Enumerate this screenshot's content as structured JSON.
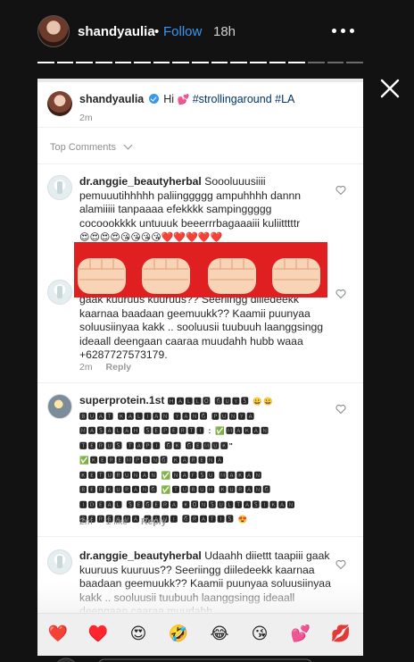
{
  "story": {
    "username": "shandyaulia",
    "separator": "•",
    "follow_label": "Follow",
    "time_ago": "18h",
    "progress_total": 17,
    "progress_current": 14
  },
  "post": {
    "username": "shandyaulia",
    "caption_hi": "Hi",
    "caption_tags": "#strollingaround #LA",
    "age": "2m"
  },
  "top_comments_label": "Top Comments",
  "comments": [
    {
      "username": "dr.anggie_beautyherbal",
      "text": "Soooluuusiiii pemuuutihhhhh paliinggggg ampuhhhh dannn alamiiiii tanpaaaa efekkkk sampinggggg cocoookkkk untuuuk beeerrrbagaaaiii kuliitttttr",
      "emojis": "😍😍😍😍😘😘😘😘❤️❤️❤️❤️❤️"
    },
    {
      "text": "gaak kuuruus kuuruus?? Seeriingg diiledeekk kaarnaa baadaan geemuukk?? Kaamii puunyaa soluusiinyaa kakk .. sooluusii tuubuuh laanggsingg ideaall deengaan caaraa muudahh hubb waaa +6287727573179.",
      "age": "2m",
      "reply": "Reply"
    },
    {
      "username": "superprotein.1st",
      "text_lines": [
        "🅷🅰🅻🅻🅾 🅶🆄🆈🆂 😀😀",
        "🅱🆄🅰🆃 🅺🅰🅻🅸🅰🅽 🆈🅰🅽🅶 🅿🆄🅽🆈🅰",
        "🅼🅰🆂🅰🅻🅰🅷 🆂🅴🅿🅴🆁🆃🅸 : ✅🅼🅰🅺🅰🅽",
        "🆃🅴🆁🆄🆂 🆃🅰🅿🅸 🅶🅺 🅶🅴🅼🆄🅺\"",
        "✅🅺🅴🆁🅴🅼🅿🅴🅽🅶 🅺🅰🆁🅴🅽🅰",
        "🅺🅴🆃🆄🆁🆄🅽🅰🅽 ✅🅽🅰🅵🆂🆄 🅼🅰🅺🅰🅽",
        "🅱🅴🆁🅺🆄🆁🅰🅽🅶 ✅🆃🆄🅱🆄🅷 🅺🆄🆁🅰🅽🅶",
        "🅸🅳🅴🅰🅻 🆂🅴🅶🅴🆁🅰 🅺🅾🅽🆂🆄🅻🆃🅰🆂🅸🅺🅰🅽",
        "🅱🅴🆁🆂🅰🅼🅰 🅺🅰🅼🅸 🅶🆁🅰🆃🅸🆂 😍"
      ],
      "age": "2m",
      "likes": "1 like",
      "reply": "Reply"
    },
    {
      "username": "dr.anggie_beautyherbal",
      "text": "Udaahh diiettt taapiii gaak kuuruus kuuruus?? Seeriingg diiledeekk kaarnaa baadaan geemuukk?? Kaamii puunyaa soluusiinyaa kakk .. sooluusii tuubuuh laanggsingg ideaall deengaan caaraa muudahh"
    }
  ],
  "emoji_bar": [
    "❤️",
    "♥️",
    "😍",
    "🤣",
    "😂",
    "😘",
    "💕",
    "💋"
  ],
  "colors": {
    "follow": "#3897f0",
    "fist_band": "#e02020",
    "story_background": "#121212"
  },
  "icons": [
    "more-icon",
    "close-icon",
    "heart-outline-icon",
    "verified-badge-icon",
    "chevron-down-icon",
    "fist-icon"
  ]
}
